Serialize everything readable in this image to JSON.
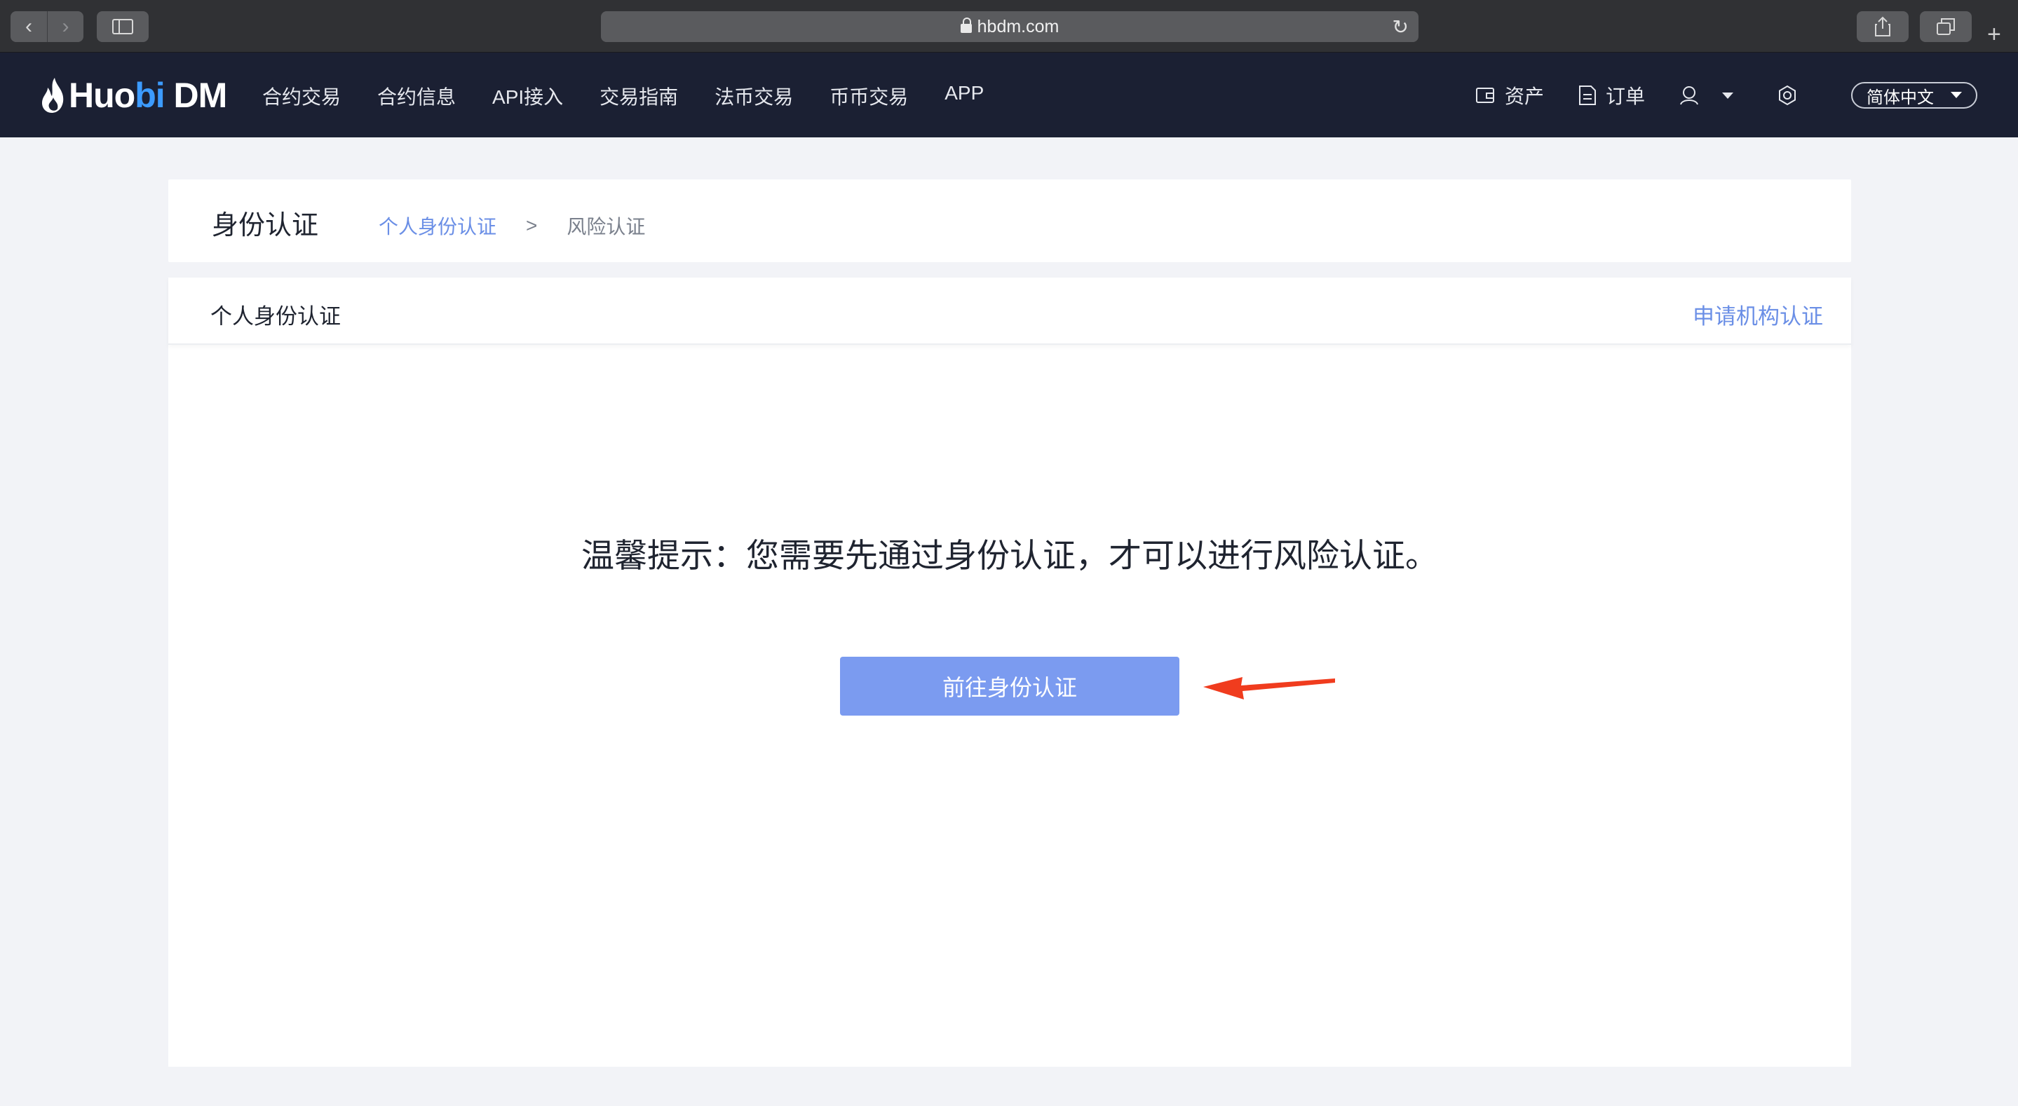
{
  "browser": {
    "url": "hbdm.com"
  },
  "header": {
    "logo_main": "Huo",
    "logo_accent": "bi",
    "logo_suffix": " DM",
    "nav": [
      "合约交易",
      "合约信息",
      "API接入",
      "交易指南",
      "法币交易",
      "币币交易",
      "APP"
    ],
    "assets_label": "资产",
    "orders_label": "订单",
    "language": "简体中文"
  },
  "page": {
    "title": "身份认证",
    "breadcrumb": {
      "active": "个人身份认证",
      "separator": ">",
      "next": "风险认证"
    },
    "card": {
      "header_title": "个人身份认证",
      "header_link": "申请机构认证",
      "tip": "温馨提示：您需要先通过身份认证，才可以进行风险认证。",
      "button_label": "前往身份认证"
    }
  },
  "colors": {
    "header_bg": "#1b2033",
    "accent_link": "#6b8fe6",
    "button_bg": "#7b9bf0",
    "annotation_arrow": "#f03c1e"
  }
}
